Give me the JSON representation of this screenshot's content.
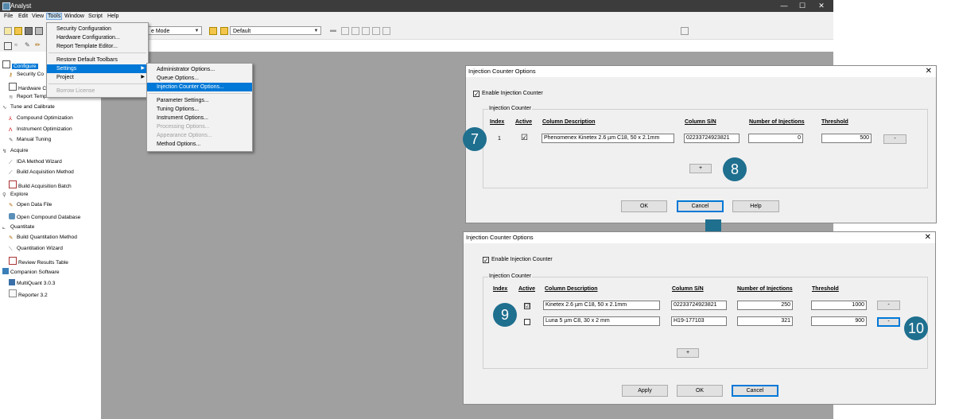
{
  "app": {
    "title": "Analyst"
  },
  "window_buttons": {
    "minimize": "—",
    "maximize": "☐",
    "close": "✕"
  },
  "menubar": [
    "File",
    "Edit",
    "View",
    "Tools",
    "Window",
    "Script",
    "Help"
  ],
  "toolbar": {
    "mode_combo": "e Mode",
    "project_combo": "Default"
  },
  "nav": {
    "configure": "Configure",
    "security": "Security Co",
    "hardware": "Hardware C",
    "report": "Report Template Editor",
    "tune_calibrate": "Tune and Calibrate",
    "compound_opt": "Compound Optimization",
    "instrument_opt": "Instrument Optimization",
    "manual_tuning": "Manual Tuning",
    "acquire": "Acquire",
    "ida": "IDA Method Wizard",
    "build_acq_method": "Build Acquisition Method",
    "build_acq_batch": "Build Acquisition Batch",
    "explore": "Explore",
    "open_data": "Open Data File",
    "open_compound_db": "Open Compound Database",
    "quantitate": "Quantitate",
    "build_quant": "Build Quantitation Method",
    "quant_wizard": "Quantitation Wizard",
    "review_results": "Review Results Table",
    "companion": "Companion Software",
    "multiquant": "MultiQuant 3.0.3",
    "reporter": "Reporter 3.2"
  },
  "tools_menu": {
    "security": "Security Configuration",
    "hardware": "Hardware Configuration...",
    "report": "Report Template Editor...",
    "restore": "Restore Default Toolbars",
    "settings": "Settings",
    "project": "Project",
    "borrow": "Borrow License",
    "submenu_arrow": "▶"
  },
  "settings_menu": {
    "administrator": "Administrator Options...",
    "queue": "Queue Options...",
    "injection": "Injection Counter Options...",
    "parameter": "Parameter Settings...",
    "tuning": "Tuning Options...",
    "instrument": "Instrument Options...",
    "processing": "Processing Options...",
    "appearance": "Appearance Options...",
    "method": "Method Options..."
  },
  "dialog1": {
    "title": "Injection Counter Options",
    "close": "✕",
    "enable_label": "Enable Injection Counter",
    "group_label": "Injection Counter",
    "headers": {
      "index": "Index",
      "active": "Active",
      "desc": "Column Description",
      "sn": "Column S/N",
      "injections": "Number of Injections",
      "threshold": "Threshold"
    },
    "row": {
      "index": "1",
      "active": "☑",
      "desc": "Phenomenex Kinetex 2.6 µm C18, 50 x 2.1mm",
      "sn": "02233724923821",
      "injections": "0",
      "threshold": "500",
      "remove": "-"
    },
    "add": "+",
    "ok": "OK",
    "cancel": "Cancel",
    "help": "Help"
  },
  "dialog2": {
    "title": "Injection Counter Options",
    "close": "✕",
    "enable_label": "Enable Injection Counter",
    "group_label": "Injection Counter",
    "headers": {
      "index": "Index",
      "active": "Active",
      "desc": "Column Description",
      "sn": "Column S/N",
      "injections": "Number of Injections",
      "threshold": "Threshold"
    },
    "rows": [
      {
        "active": "☑",
        "desc": "Kinetex 2.6 µm C18, 50 x 2.1mm",
        "sn": "02233724923821",
        "injections": "250",
        "threshold": "1000",
        "remove": "-"
      },
      {
        "active": "",
        "desc": "Luna 5 µm C8, 30 x 2 mm",
        "sn": "H19-177103",
        "injections": "321",
        "threshold": "900",
        "remove": "-"
      }
    ],
    "add": "+",
    "apply": "Apply",
    "ok": "OK",
    "cancel": "Cancel"
  },
  "callouts": {
    "b7": "7",
    "b8": "8",
    "b9": "9",
    "b10": "10"
  },
  "colors": {
    "accent": "#0078d7",
    "callout": "#1f6f8f"
  }
}
